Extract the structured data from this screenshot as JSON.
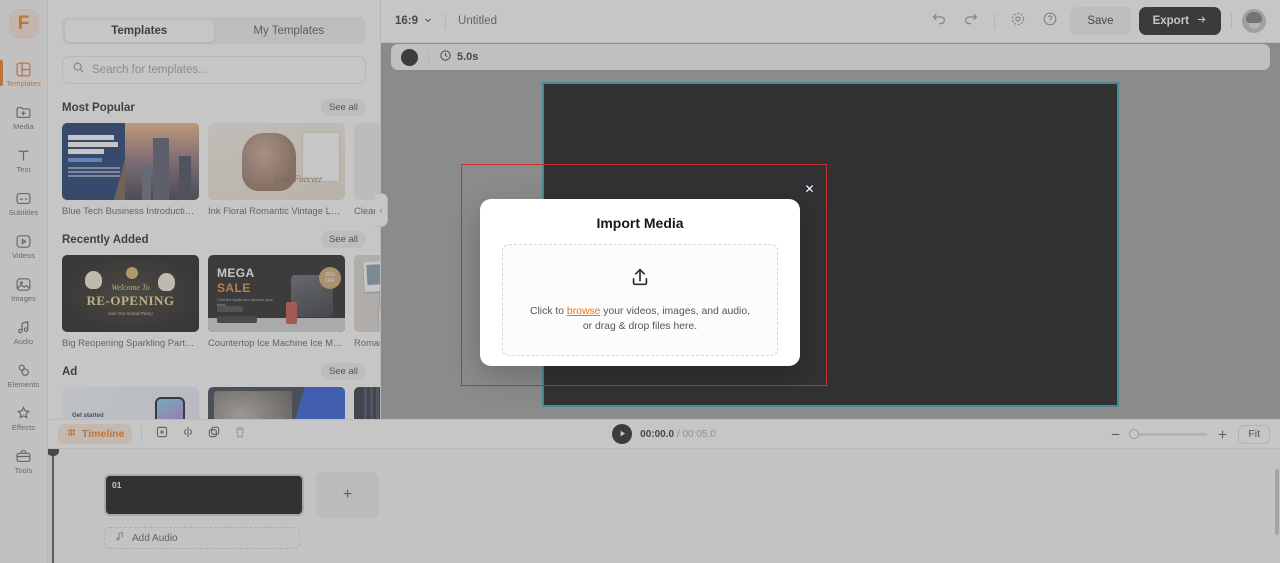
{
  "rail": {
    "logo": "F",
    "items": [
      {
        "label": "Templates",
        "icon": "templates-icon",
        "active": true
      },
      {
        "label": "Media",
        "icon": "media-folder-icon",
        "active": false
      },
      {
        "label": "Text",
        "icon": "text-icon",
        "active": false
      },
      {
        "label": "Subtitles",
        "icon": "subtitles-icon",
        "active": false
      },
      {
        "label": "Videos",
        "icon": "videos-icon",
        "active": false
      },
      {
        "label": "Images",
        "icon": "images-icon",
        "active": false
      },
      {
        "label": "Audio",
        "icon": "audio-icon",
        "active": false
      },
      {
        "label": "Elements",
        "icon": "elements-icon",
        "active": false
      },
      {
        "label": "Effects",
        "icon": "effects-icon",
        "active": false
      },
      {
        "label": "Tools",
        "icon": "tools-icon",
        "active": false
      }
    ]
  },
  "panel": {
    "tabs": [
      {
        "label": "Templates",
        "active": true
      },
      {
        "label": "My Templates",
        "active": false
      }
    ],
    "search": {
      "placeholder": "Search for templates...",
      "value": "",
      "icon": "search-icon"
    },
    "see_all_label": "See all",
    "sections": [
      {
        "title": "Most Popular",
        "cards": [
          {
            "name": "Blue Tech Business Introduction ...",
            "art": "t-blue"
          },
          {
            "name": "Ink Floral Romantic Vintage Love...",
            "art": "t-floral"
          },
          {
            "name": "Clean ...",
            "art": "t-clean"
          }
        ]
      },
      {
        "title": "Recently Added",
        "cards": [
          {
            "name": "Big Reopening Sparkling Party In...",
            "art": "t-reopen"
          },
          {
            "name": "Countertop Ice Machine Ice Mak...",
            "art": "t-mega"
          },
          {
            "name": "Roman...",
            "art": "t-roman"
          }
        ]
      },
      {
        "title": "Ad",
        "cards": [
          {
            "name": "",
            "art": "t-phone"
          },
          {
            "name": "",
            "art": "t-about"
          },
          {
            "name": "",
            "art": "t-bld"
          }
        ]
      }
    ],
    "collapse_icon": "chevron-left-icon"
  },
  "topbar": {
    "ratio": "16:9",
    "ratio_caret": "chevron-down-icon",
    "project_title": "Untitled",
    "undo_icon": "undo-icon",
    "redo_icon": "redo-icon",
    "snapshot_icon": "snapshot-icon",
    "help_icon": "help-circle-icon",
    "save_label": "Save",
    "export_label": "Export",
    "export_arrow": "arrow-right-icon",
    "avatar": "avatar"
  },
  "duration_strip": {
    "color_swatch": "#121212",
    "clock_icon": "clock-icon",
    "duration": "5.0s"
  },
  "canvas": {
    "background": "#000000",
    "selection_border_color": "#1f9aad",
    "annotation_border_color": "#ff0000"
  },
  "bottombar": {
    "timeline_label": "Timeline",
    "timeline_icon": "timeline-icon",
    "tools": [
      {
        "name": "add-icon",
        "dim": false
      },
      {
        "name": "split-icon",
        "dim": false
      },
      {
        "name": "duplicate-icon",
        "dim": false
      },
      {
        "name": "delete-icon",
        "dim": true
      }
    ],
    "play_icon": "play-icon",
    "current_time": "00:00.0",
    "time_separator": "/",
    "total_time": "00:05.0",
    "zoom_out_icon": "minus-icon",
    "zoom_in_icon": "plus-icon",
    "zoom_value": 6,
    "fit_label": "Fit"
  },
  "timeline": {
    "clip_label": "01",
    "add_clip_label": "+",
    "add_audio_label": "Add Audio",
    "add_audio_icon": "music-note-icon"
  },
  "modal": {
    "title": "Import Media",
    "upload_icon": "upload-arrow-icon",
    "text_before": "Click to ",
    "link": "browse",
    "text_after": " your videos, images, and audio,",
    "text_line2": "or drag & drop files here.",
    "close_icon": "close-icon",
    "accent_color": "#f0720f"
  }
}
